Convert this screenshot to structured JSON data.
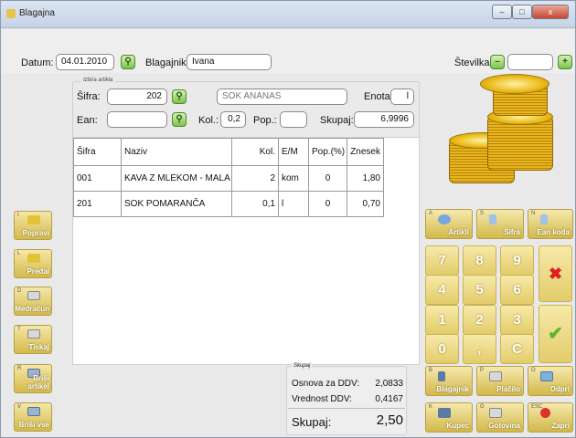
{
  "window": {
    "title": "Blagajna",
    "min_label": "–",
    "max_label": "□",
    "close_label": "x"
  },
  "header": {
    "datum_label": "Datum:",
    "datum_value": "04.01.2010",
    "blagajnik_label": "Blagajnik:",
    "blagajnik_value": "Ivana",
    "stevilka_label": "Številka:",
    "stevilka_value": ""
  },
  "artikel": {
    "group_label": "Izbira artikla",
    "sifra_label": "Šifra:",
    "sifra_value": "202",
    "naziv_value": "SOK ANANAS",
    "enota_label": "Enota:",
    "enota_value": "l",
    "ean_label": "Ean:",
    "ean_value": "",
    "kol_label": "Kol.:",
    "kol_value": "0,2",
    "pop_label": "Pop.:",
    "pop_value": "",
    "skupaj_label": "Skupaj:",
    "skupaj_value": "6,9996"
  },
  "table": {
    "headers": [
      "Šifra",
      "Naziv",
      "Kol.",
      "E/M",
      "Pop.(%)",
      "Znesek"
    ],
    "rows": [
      [
        "001",
        "KAVA Z MLEKOM - MALA",
        "2",
        "kom",
        "0",
        "1,80"
      ],
      [
        "201",
        "SOK POMARANČA",
        "0,1",
        "l",
        "0",
        "0,70"
      ]
    ]
  },
  "left_buttons": [
    {
      "key": "I",
      "label": "Popravi",
      "icon": "folder-icon"
    },
    {
      "key": "L",
      "label": "Predal",
      "icon": "folder-icon"
    },
    {
      "key": "D",
      "label": "Medračun",
      "icon": "printer-icon"
    },
    {
      "key": "T",
      "label": "Tiskaj",
      "icon": "printer-icon"
    },
    {
      "key": "R",
      "label": "Briši artikel",
      "icon": "trash-icon"
    },
    {
      "key": "V",
      "label": "Briši vse",
      "icon": "trash-icon"
    }
  ],
  "top_func": [
    {
      "key": "A",
      "label": "Artikli",
      "icon": "search-icon"
    },
    {
      "key": "S",
      "label": "Šifra",
      "icon": "pen-icon"
    },
    {
      "key": "N",
      "label": "Ean koda",
      "icon": "pen-icon"
    }
  ],
  "keypad": [
    "7",
    "8",
    "9",
    "4",
    "5",
    "6",
    "1",
    "2",
    "3",
    "0",
    ",",
    "C"
  ],
  "cancel_symbol": "✖",
  "ok_symbol": "✔",
  "bottom_func": [
    {
      "key": "B",
      "label": "Blagajnik",
      "icon": "user-icon"
    },
    {
      "key": "P",
      "label": "Plačilo",
      "icon": "printer-icon"
    },
    {
      "key": "O",
      "label": "Odpri",
      "icon": "drawer-icon"
    },
    {
      "key": "K",
      "label": "Kupec",
      "icon": "users-icon"
    },
    {
      "key": "G",
      "label": "Gotovina",
      "icon": "printer-icon"
    },
    {
      "key": "ESC",
      "label": "Zapri",
      "icon": "close-icon"
    }
  ],
  "summary": {
    "group_label": "Skupaj",
    "osnova_label": "Osnova za DDV:",
    "osnova_value": "2,0833",
    "ddv_label": "Vrednost DDV:",
    "ddv_value": "0,4167",
    "skupaj_label": "Skupaj:",
    "skupaj_value": "2,50"
  },
  "colors": {
    "button_gold": "#e3cc6a",
    "cancel_red": "#e02020",
    "ok_green": "#5ab82e"
  }
}
